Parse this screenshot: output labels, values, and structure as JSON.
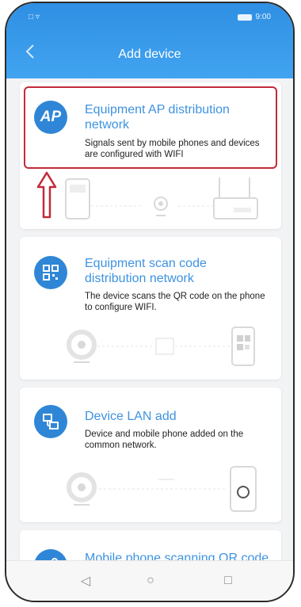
{
  "status": {
    "left": "□ ▿",
    "right": "9:00"
  },
  "header": {
    "title": "Add device",
    "back_icon": "chevron-left-icon"
  },
  "colors": {
    "header": "#3e9ae8",
    "accent": "#3e93e0",
    "highlight": "#c22a3b",
    "badge": "#2f86d6"
  },
  "cards": [
    {
      "badge": "AP",
      "title": "Equipment AP distribution network",
      "description": "Signals sent by mobile phones and devices are configured with WIFI"
    },
    {
      "badge_icon": "qr-scan-icon",
      "title": "Equipment scan code distribution network",
      "description": "The device scans the QR code on the phone to configure WIFI."
    },
    {
      "badge_icon": "lan-icon",
      "title": "Device LAN add",
      "description": "Device and mobile phone added on the common network."
    },
    {
      "badge_icon": "share-icon",
      "title": "Mobile phone scanning QR code sharing to add",
      "description": ""
    }
  ],
  "navbar": {
    "back": "◁",
    "home": "○",
    "recent": "□"
  }
}
